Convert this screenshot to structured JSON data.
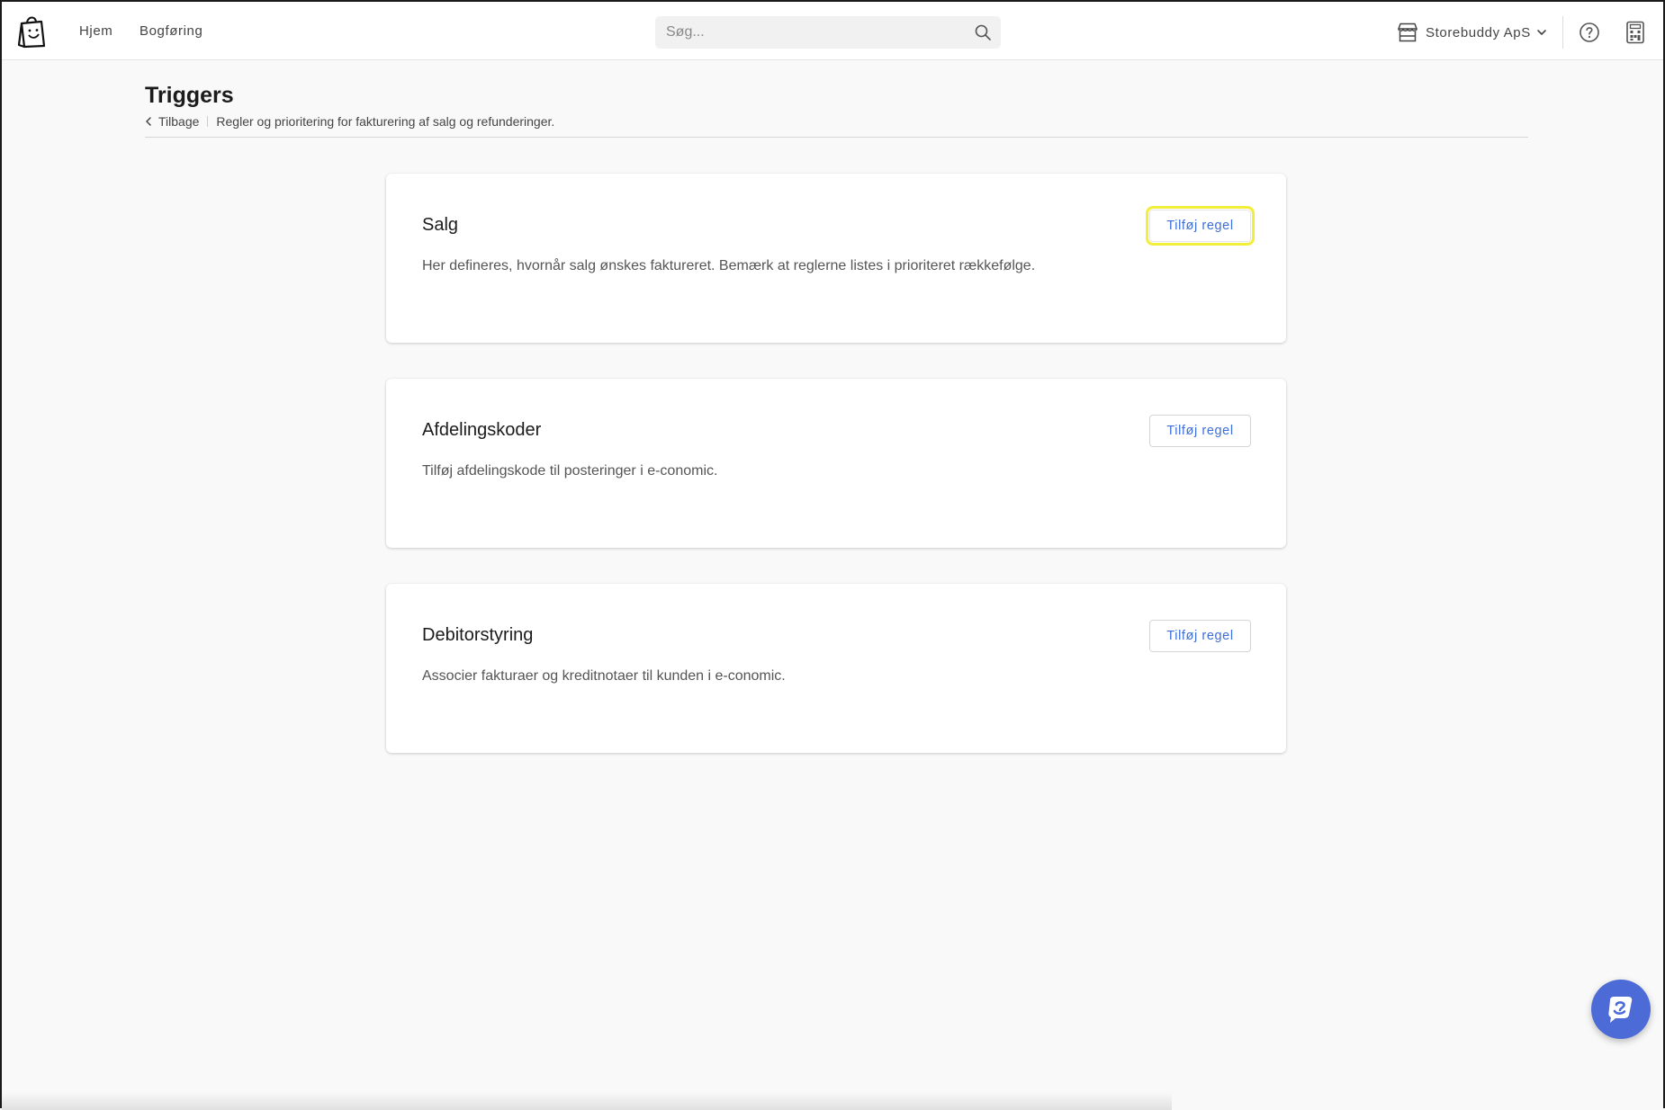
{
  "nav": {
    "items": [
      {
        "label": "Hjem"
      },
      {
        "label": "Bogføring"
      }
    ]
  },
  "search": {
    "placeholder": "Søg...",
    "value": ""
  },
  "account": {
    "store_name": "Storebuddy ApS"
  },
  "icons": {
    "logo": "shopping-bag-logo",
    "search": "search-icon",
    "store": "store-icon",
    "help": "help-icon",
    "calculator": "calculator-icon",
    "chat": "chat-icon"
  },
  "page": {
    "title": "Triggers",
    "back_label": "Tilbage",
    "subtitle": "Regler og prioritering for fakturering af salg og refunderinger."
  },
  "cards": [
    {
      "title": "Salg",
      "description": "Her defineres, hvornår salg ønskes faktureret. Bemærk at reglerne listes i prioriteret rækkefølge.",
      "button_label": "Tilføj regel"
    },
    {
      "title": "Afdelingskoder",
      "description": "Tilføj afdelingskode til posteringer i e-conomic.",
      "button_label": "Tilføj regel"
    },
    {
      "title": "Debitorstyring",
      "description": "Associer fakturaer og kreditnotaer til kunden i e-conomic.",
      "button_label": "Tilføj regel"
    }
  ],
  "colors": {
    "accent": "#3d6fd8",
    "chat_button": "#4c6bd6",
    "highlight": "#f2ee3a",
    "background": "#f9f9f9"
  }
}
